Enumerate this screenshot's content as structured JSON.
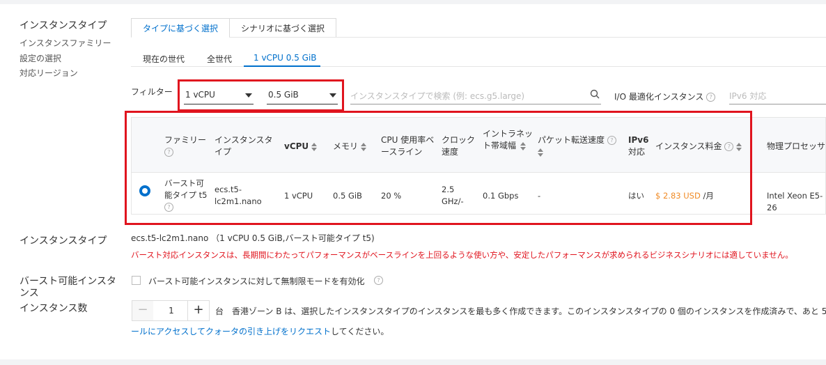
{
  "labels": {
    "instance_type_section": "インスタンスタイプ",
    "family_selection_1": "インスタンスファミリー",
    "family_selection_2": "設定の選択",
    "supported_region": "対応リージョン",
    "instance_type": "インスタンスタイプ",
    "burstable": "バースト可能インスタンス",
    "instance_count": "インスタンス数"
  },
  "tabs": [
    {
      "label": "タイプに基づく選択"
    },
    {
      "label": "シナリオに基づく選択"
    }
  ],
  "generations": [
    "現在の世代",
    "全世代",
    "1 vCPU 0.5 GiB"
  ],
  "filter": {
    "label": "フィルター",
    "vcpu": "1 vCPU",
    "memory": "0.5 GiB",
    "search_placeholder": "インスタンスタイプで検索 (例: ecs.g5.large)",
    "io_optimized": "I/O 最適化インスタンス",
    "ipv6": "IPv6 対応"
  },
  "table": {
    "headers": [
      "ファミリー",
      "インスタンスタイプ",
      "vCPU",
      "メモリ",
      "CPU 使用率ベースライン",
      "クロック速度",
      "イントラネット帯域幅",
      "パケット転送速度",
      "IPv6",
      "対応",
      "インスタンス料金",
      "物理プロセッサ"
    ],
    "row": {
      "family": "バースト可能タイプ t5",
      "instance_type": "ecs.t5-lc2m1.nano",
      "vcpu": "1 vCPU",
      "memory": "0.5 GiB",
      "cpu_baseline": "20 %",
      "clock_speed": "2.5 GHz/-",
      "bandwidth": "0.1 Gbps",
      "packet_rate": "-",
      "ipv6": "はい",
      "price": "$ 2.83 USD",
      "price_unit": "/月",
      "processor": "Intel Xeon E5-26"
    }
  },
  "summary": {
    "selected": "ecs.t5-lc2m1.nano （1 vCPU 0.5 GiB,バースト可能タイプ t5)",
    "warning": "バースト対応インスタンスは、長期間にわたってパフォーマンスがベースラインを上回るような使い方や、安定したパフォーマンスが求められるビジネスシナリオには適していません。"
  },
  "burstable": {
    "checkbox_label": "バースト可能インスタンスに対して無制限モードを有効化"
  },
  "count": {
    "value": "1",
    "note": "台　香港ゾーン B は、選択したインスタンスタイプのインスタンスを最も多く作成できます。このインスタンスタイプの 0 個のインスタンスを作成済みで、あと 5",
    "link": "ールにアクセスしてクォータの引き上げをリクエスト",
    "link_suffix": "してください。"
  }
}
